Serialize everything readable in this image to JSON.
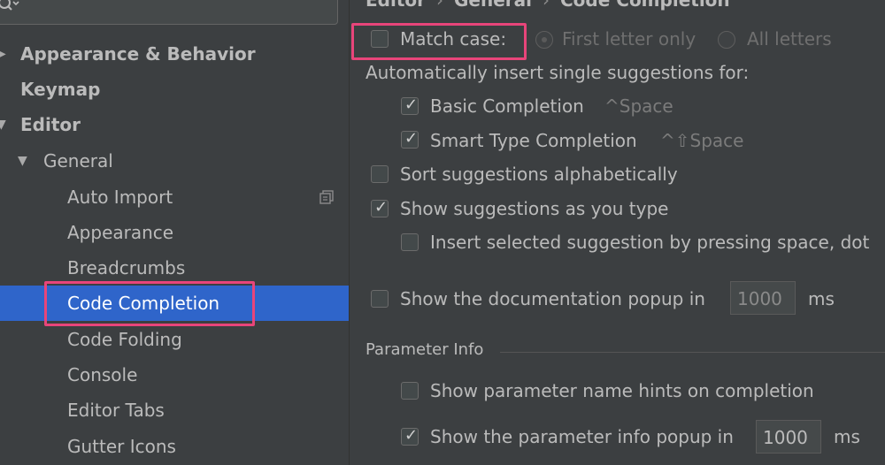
{
  "sidebar": {
    "items": [
      {
        "label": "Appearance & Behavior",
        "arrow": "▶"
      },
      {
        "label": "Keymap"
      },
      {
        "label": "Editor",
        "arrow": "▼"
      },
      {
        "label": "General",
        "arrow": "▼"
      },
      {
        "label": "Auto Import"
      },
      {
        "label": "Appearance"
      },
      {
        "label": "Breadcrumbs"
      },
      {
        "label": "Code Completion"
      },
      {
        "label": "Code Folding"
      },
      {
        "label": "Console"
      },
      {
        "label": "Editor Tabs"
      },
      {
        "label": "Gutter Icons"
      }
    ]
  },
  "breadcrumb": {
    "items": [
      "Editor",
      "General",
      "Code Completion"
    ],
    "separator": "›"
  },
  "settings": {
    "match_case": {
      "label": "Match case:",
      "checked": false
    },
    "first_letter_only": "First letter only",
    "all_letters": "All letters",
    "auto_insert_heading": "Automatically insert single suggestions for:",
    "basic_completion": {
      "label": "Basic Completion",
      "shortcut": "^Space",
      "checked": true
    },
    "smart_completion": {
      "label": "Smart Type Completion",
      "shortcut": "^⇧Space",
      "checked": true
    },
    "sort_alpha": {
      "label": "Sort suggestions alphabetically",
      "checked": false
    },
    "show_as_type": {
      "label": "Show suggestions as you type",
      "checked": true
    },
    "insert_space": {
      "label": "Insert selected suggestion by pressing space, dot",
      "checked": false
    },
    "doc_popup": {
      "label": "Show the documentation popup in",
      "value": "1000",
      "unit": "ms",
      "checked": false
    },
    "param_info_title": "Parameter Info",
    "param_hints": {
      "label": "Show parameter name hints on completion",
      "checked": false
    },
    "param_popup": {
      "label": "Show the parameter info popup in",
      "value": "1000",
      "unit": "ms",
      "checked": true
    }
  },
  "colors": {
    "selection": "#2f65ca",
    "highlight": "#e8457a",
    "background": "#3c3f41"
  }
}
